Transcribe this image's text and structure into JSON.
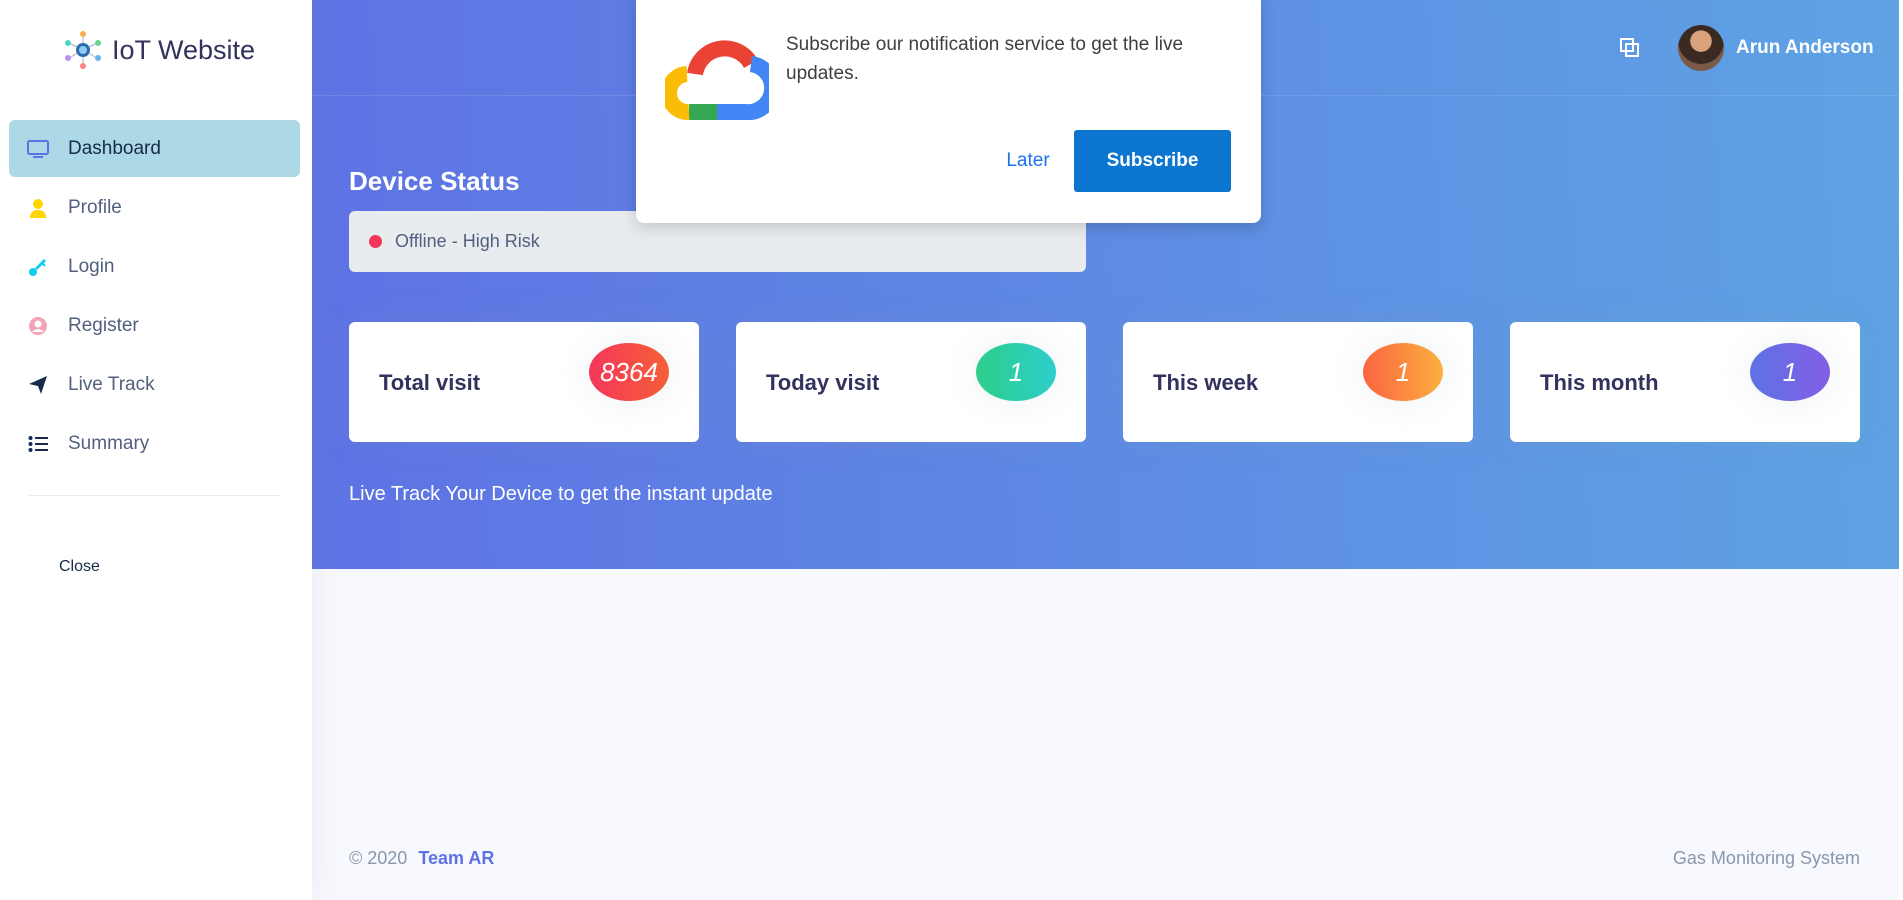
{
  "brand": {
    "title": "IoT Website"
  },
  "sidebar": {
    "items": [
      {
        "label": "Dashboard",
        "icon": "monitor-icon",
        "active": true
      },
      {
        "label": "Profile",
        "icon": "user-icon",
        "active": false
      },
      {
        "label": "Login",
        "icon": "key-icon",
        "active": false
      },
      {
        "label": "Register",
        "icon": "user-circle-icon",
        "active": false
      },
      {
        "label": "Live Track",
        "icon": "send-icon",
        "active": false
      },
      {
        "label": "Summary",
        "icon": "list-icon",
        "active": false
      }
    ],
    "close_label": "Close"
  },
  "header": {
    "user_name": "Arun Anderson"
  },
  "device_status": {
    "title": "Device Status",
    "status_text": "Offline - High Risk",
    "status_color": "#f5365c"
  },
  "stats": [
    {
      "label": "Total visit",
      "value": "8364",
      "color": "red"
    },
    {
      "label": "Today visit",
      "value": "1",
      "color": "green"
    },
    {
      "label": "This week",
      "value": "1",
      "color": "orange"
    },
    {
      "label": "This month",
      "value": "1",
      "color": "purple"
    }
  ],
  "live_track_text": "Live Track Your Device to get the instant update",
  "footer": {
    "copyright": "© 2020",
    "team": "Team AR",
    "right_text": "Gas Monitoring System"
  },
  "popup": {
    "message": "Subscribe our notification service to get the live updates.",
    "later_label": "Later",
    "subscribe_label": "Subscribe"
  },
  "colors": {
    "gradient_start": "#5e72e4",
    "gradient_end": "#5ea3e4",
    "active_nav": "#add8e6",
    "subscribe_button": "#0b75cf"
  }
}
